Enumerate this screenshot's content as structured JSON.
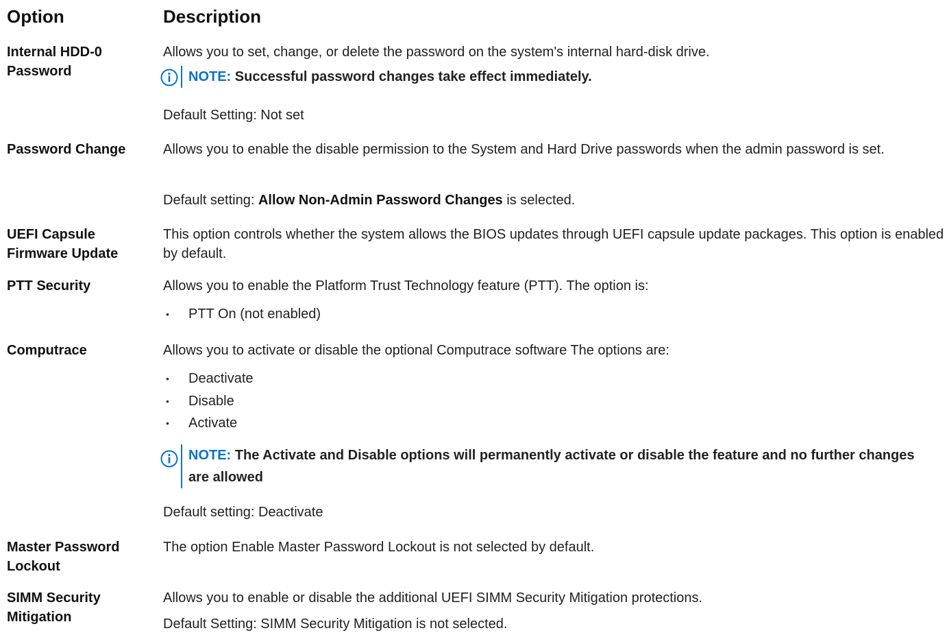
{
  "header": {
    "option": "Option",
    "description": "Description"
  },
  "rows": {
    "hdd_password": {
      "option": "Internal HDD-0 Password",
      "desc": "Allows you to set, change, or delete the password on the system's internal hard-disk drive.",
      "note_label": "NOTE:",
      "note_text": "Successful password changes take effect immediately.",
      "default": "Default Setting: Not set"
    },
    "password_change": {
      "option": "Password Change",
      "desc": "Allows you to enable the disable permission to the System and Hard Drive passwords when the admin password is set.",
      "default_prefix": "Default setting:",
      "default_value": "Allow Non-Admin Password Changes",
      "default_suffix": "is selected."
    },
    "uefi_capsule": {
      "option": "UEFI Capsule Firmware Update",
      "desc": "This option controls whether the system allows the BIOS updates through UEFI capsule update packages. This option is enabled by default."
    },
    "ptt_security": {
      "option": "PTT Security",
      "desc": "Allows you to enable the Platform Trust Technology feature (PTT). The option is:",
      "bullets": [
        "PTT On (not enabled)"
      ]
    },
    "computrace": {
      "option": "Computrace",
      "desc": "Allows you to activate or disable the optional Computrace software The options are:",
      "bullets": [
        "Deactivate",
        "Disable",
        "Activate"
      ],
      "note_label": "NOTE:",
      "note_text": "The Activate and Disable options will permanently activate or disable the feature and no further changes are allowed",
      "default": "Default setting: Deactivate"
    },
    "master_password_lockout": {
      "option": "Master Password Lockout",
      "desc": "The option Enable Master Password Lockout is not selected by default."
    },
    "simm_security": {
      "option": "SIMM Security Mitigation",
      "desc": "Allows you to enable or disable the additional UEFI SIMM Security Mitigation protections.",
      "default": "Default Setting: SIMM Security Mitigation is not selected."
    }
  },
  "colors": {
    "accent": "#0672cb",
    "text": "#1f1f1f"
  },
  "icons": {
    "note": "info-circle-icon",
    "bullet": "bullet-dot"
  }
}
